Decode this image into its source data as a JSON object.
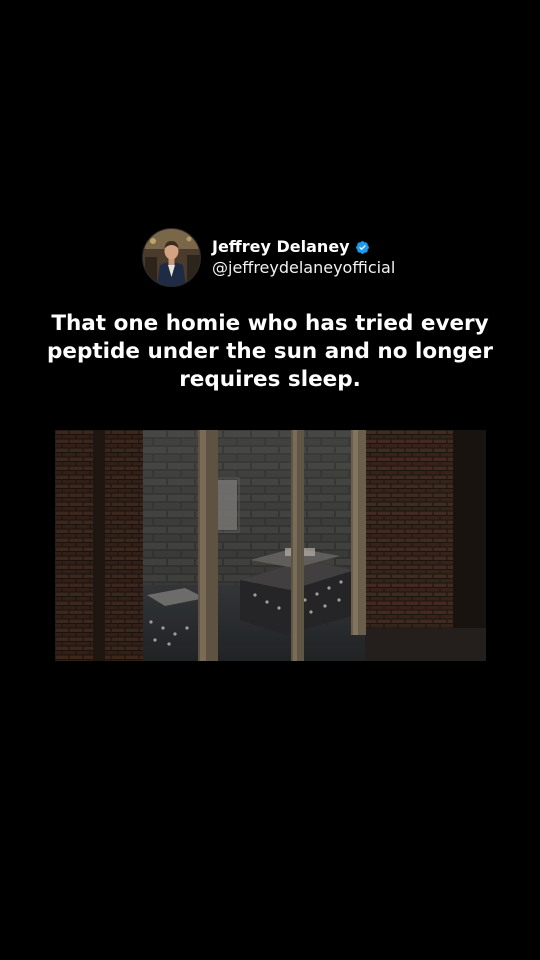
{
  "post": {
    "author_name": "Jeffrey Delaney",
    "author_handle": "@jeffreydelaneyofficial",
    "verified": true,
    "caption": "That one homie who has tried every peptide under the sun and no longer requires sleep."
  },
  "icons": {
    "verified": "verified-badge-icon",
    "avatar": "profile-photo"
  },
  "colors": {
    "background": "#000000",
    "text": "#ffffff",
    "verified_badge": "#1d9bf0"
  }
}
